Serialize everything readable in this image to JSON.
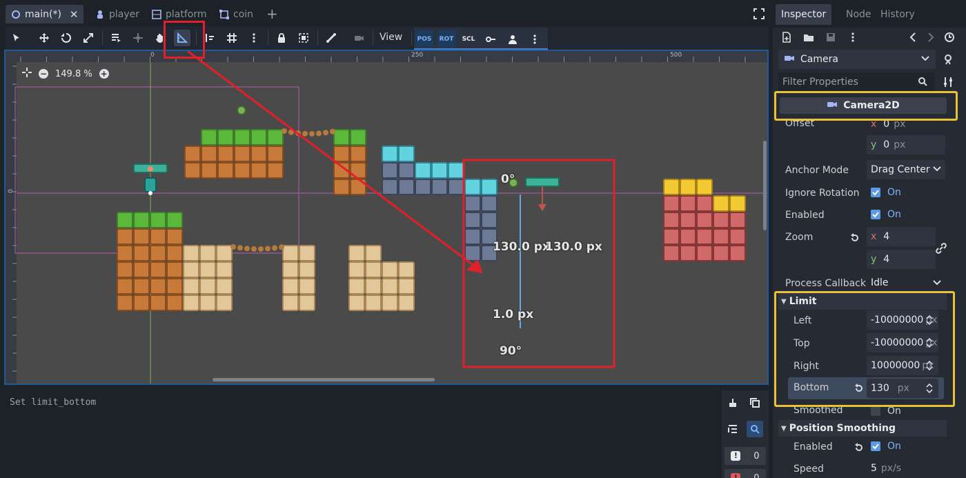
{
  "tabs": [
    {
      "label": "main(*)",
      "active": true
    },
    {
      "label": "player",
      "active": false
    },
    {
      "label": "platform",
      "active": false
    },
    {
      "label": "coin",
      "active": false
    }
  ],
  "toolbar": {
    "view_label": "View",
    "snap_labels": [
      "POS",
      "ROT",
      "SCL"
    ]
  },
  "viewport": {
    "zoom_label": "149.8 %",
    "ruler_labels": [
      "0",
      "250",
      "500"
    ],
    "ruler_left_label": "0",
    "measure": {
      "angle_top": "0°",
      "width_label": "130.0 px",
      "height_label": "130.0 px",
      "length_label": "1.0 px",
      "angle_bottom": "90°"
    }
  },
  "output": {
    "log_text": "Set limit_bottom",
    "warnings": "0",
    "errors": "0"
  },
  "inspector": {
    "tabs": [
      "Inspector",
      "Node",
      "History"
    ],
    "object_name": "Camera",
    "filter_placeholder": "Filter Properties",
    "class_name": "Camera2D",
    "props": {
      "offset": {
        "label": "Offset",
        "x": "0",
        "y": "0",
        "unit": "px"
      },
      "anchor_mode": {
        "label": "Anchor Mode",
        "value": "Drag Center"
      },
      "ignore_rotation": {
        "label": "Ignore Rotation",
        "value": "On",
        "checked": true
      },
      "enabled": {
        "label": "Enabled",
        "value": "On",
        "checked": true
      },
      "zoom": {
        "label": "Zoom",
        "x": "4",
        "y": "4"
      },
      "process_callback": {
        "label": "Process Callback",
        "value": "Idle"
      }
    },
    "limit": {
      "title": "Limit",
      "left": {
        "label": "Left",
        "value": "-10000000",
        "unit": "px"
      },
      "top": {
        "label": "Top",
        "value": "-10000000",
        "unit": "px"
      },
      "right": {
        "label": "Right",
        "value": "10000000",
        "unit": "px"
      },
      "bottom": {
        "label": "Bottom",
        "value": "130",
        "unit": "px"
      },
      "smoothed": {
        "label": "Smoothed",
        "value": "On",
        "checked": false
      }
    },
    "position_smoothing": {
      "title": "Position Smoothing",
      "enabled": {
        "label": "Enabled",
        "value": "On",
        "checked": true
      },
      "speed": {
        "label": "Speed",
        "value": "5",
        "unit": "px/s"
      }
    }
  },
  "colors": {
    "accent": "#5c9be6",
    "annotation_red": "#e0202a",
    "annotation_yellow": "#e8c237"
  }
}
